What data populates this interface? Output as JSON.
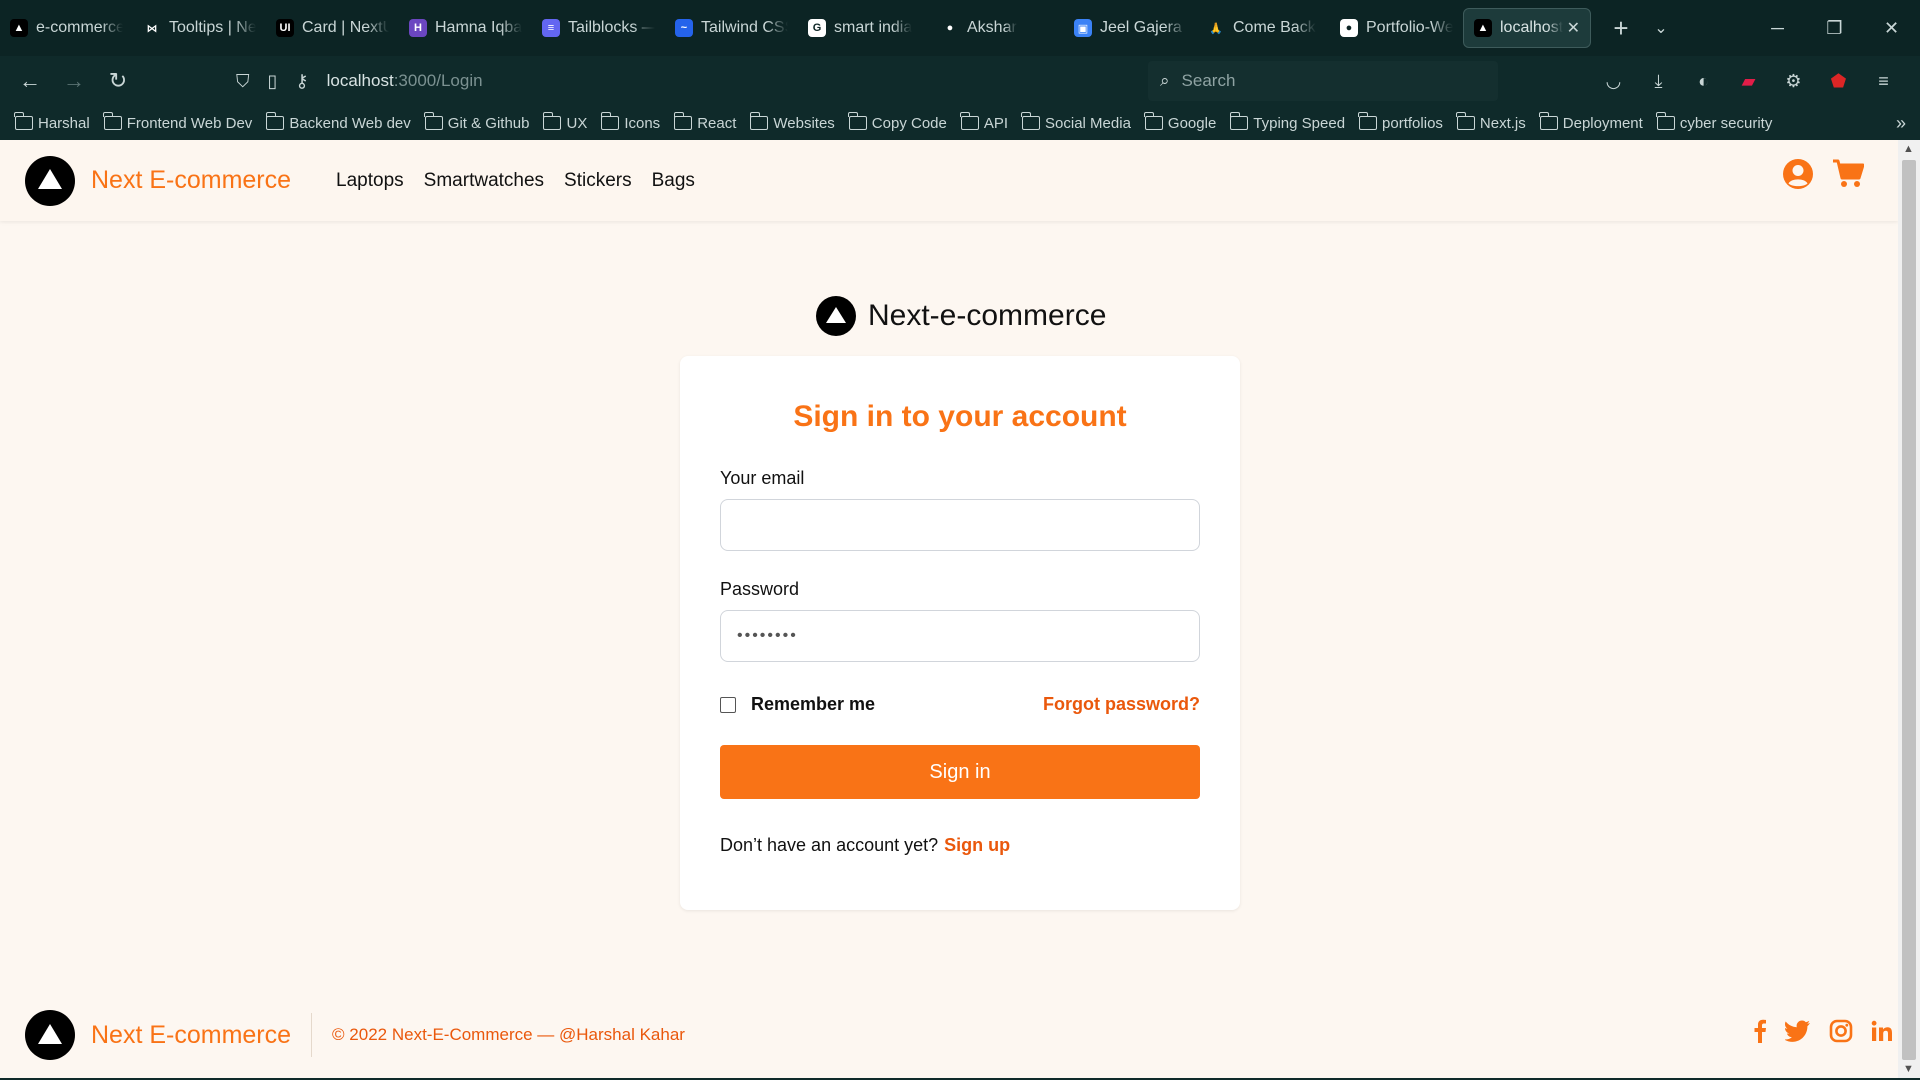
{
  "browser": {
    "tabs": [
      {
        "label": "e-commerce",
        "icon": "next-logo-icon",
        "color": "#000000",
        "glyph": "▲"
      },
      {
        "label": "Tooltips | Ne",
        "icon": "bowtie-icon",
        "color": "#0c2424",
        "glyph": "⋈"
      },
      {
        "label": "Card | NextU",
        "icon": "nextui-icon",
        "color": "#000000",
        "glyph": "UI"
      },
      {
        "label": "Hamna Iqba",
        "icon": "hashnode-icon",
        "color": "#6b46c1",
        "glyph": "H"
      },
      {
        "label": "Tailblocks —",
        "icon": "tailblocks-icon",
        "color": "#6366f1",
        "glyph": "≡"
      },
      {
        "label": "Tailwind CSS",
        "icon": "tailwind-icon",
        "color": "#2563eb",
        "glyph": "~"
      },
      {
        "label": "smart india",
        "icon": "google-icon",
        "color": "#ffffff",
        "glyph": "G"
      },
      {
        "label": "Akshar",
        "icon": "github-icon",
        "color": "#0c2424",
        "glyph": "●"
      },
      {
        "label": "Jeel Gajera |",
        "icon": "store-icon",
        "color": "#3b82f6",
        "glyph": "▣"
      },
      {
        "label": "Come Back",
        "icon": "prayer-icon",
        "color": "#0c2424",
        "glyph": "🙏"
      },
      {
        "label": "Portfolio-We",
        "icon": "github-icon",
        "color": "#ffffff",
        "glyph": "●"
      }
    ],
    "active_tab": {
      "label": "localhost:",
      "icon": "next-logo-icon"
    },
    "url": {
      "host": "localhost",
      "path": ":3000/Login"
    },
    "search_placeholder": "Search",
    "bookmarks": [
      "Harshal",
      "Frontend Web Dev",
      "Backend Web dev",
      "Git & Github",
      "UX",
      "Icons",
      "React",
      "Websites",
      "Copy Code",
      "API",
      "Social Media",
      "Google",
      "Typing Speed",
      "portfolios",
      "Next.js",
      "Deployment",
      "cyber security"
    ]
  },
  "header": {
    "brand": "Next E-commerce",
    "nav": [
      "Laptops",
      "Smartwatches",
      "Stickers",
      "Bags"
    ]
  },
  "login": {
    "site_title": "Next-e-commerce",
    "heading": "Sign in to your account",
    "email_label": "Your email",
    "email_value": "",
    "password_label": "Password",
    "password_placeholder": "••••••••",
    "remember_label": "Remember me",
    "forgot_label": "Forgot password?",
    "signin_label": "Sign in",
    "no_account_text": "Don’t have an account yet?",
    "signup_label": "Sign up"
  },
  "footer": {
    "brand": "Next E-commerce",
    "copyright": "© 2022 Next-E-Commerce — @Harshal Kahar"
  },
  "colors": {
    "accent": "#f97316",
    "page_bg": "#fdf7f1",
    "chrome_bg": "#0f2a2a"
  }
}
